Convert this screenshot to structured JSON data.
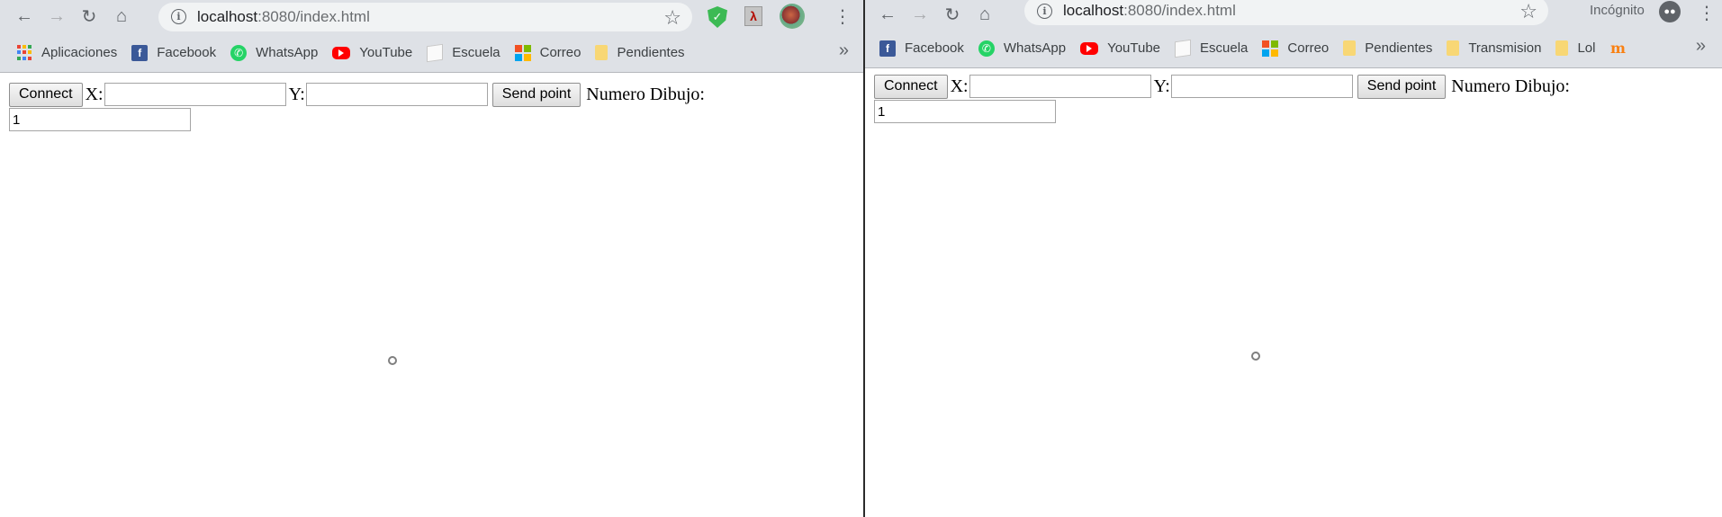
{
  "left_window": {
    "url_host": "localhost",
    "url_rest": ":8080/index.html",
    "bookmarks": [
      {
        "label": "Aplicaciones",
        "icon": "apps-icon"
      },
      {
        "label": "Facebook",
        "icon": "facebook-icon"
      },
      {
        "label": "WhatsApp",
        "icon": "whatsapp-icon"
      },
      {
        "label": "YouTube",
        "icon": "youtube-icon"
      },
      {
        "label": "Escuela",
        "icon": "document-icon"
      },
      {
        "label": "Correo",
        "icon": "microsoft-icon"
      },
      {
        "label": "Pendientes",
        "icon": "folder-icon"
      }
    ],
    "more_label": "»",
    "page": {
      "connect_label": "Connect",
      "x_label": "X:",
      "y_label": "Y:",
      "x_value": "",
      "y_value": "",
      "send_label": "Send point",
      "numero_label": "Numero Dibujo:",
      "numero_value": "1"
    }
  },
  "right_window": {
    "url_host": "localhost",
    "url_rest": ":8080/index.html",
    "incognito_label": "Incógnito",
    "bookmarks": [
      {
        "label": "Facebook",
        "icon": "facebook-icon"
      },
      {
        "label": "WhatsApp",
        "icon": "whatsapp-icon"
      },
      {
        "label": "YouTube",
        "icon": "youtube-icon"
      },
      {
        "label": "Escuela",
        "icon": "document-icon"
      },
      {
        "label": "Correo",
        "icon": "microsoft-icon"
      },
      {
        "label": "Pendientes",
        "icon": "folder-icon"
      },
      {
        "label": "Transmision",
        "icon": "folder-icon"
      },
      {
        "label": "Lol",
        "icon": "folder-icon"
      },
      {
        "label": "",
        "icon": "moodle-icon"
      }
    ],
    "more_label": "»",
    "page": {
      "connect_label": "Connect",
      "x_label": "X:",
      "y_label": "Y:",
      "x_value": "",
      "y_value": "",
      "send_label": "Send point",
      "numero_label": "Numero Dibujo:",
      "numero_value": "1"
    }
  },
  "colors": {
    "chrome_bg": "#dee1e6",
    "omnibox_bg": "#f1f3f4",
    "divider": "#2b2b2b",
    "dot": "#7f7f7f"
  }
}
